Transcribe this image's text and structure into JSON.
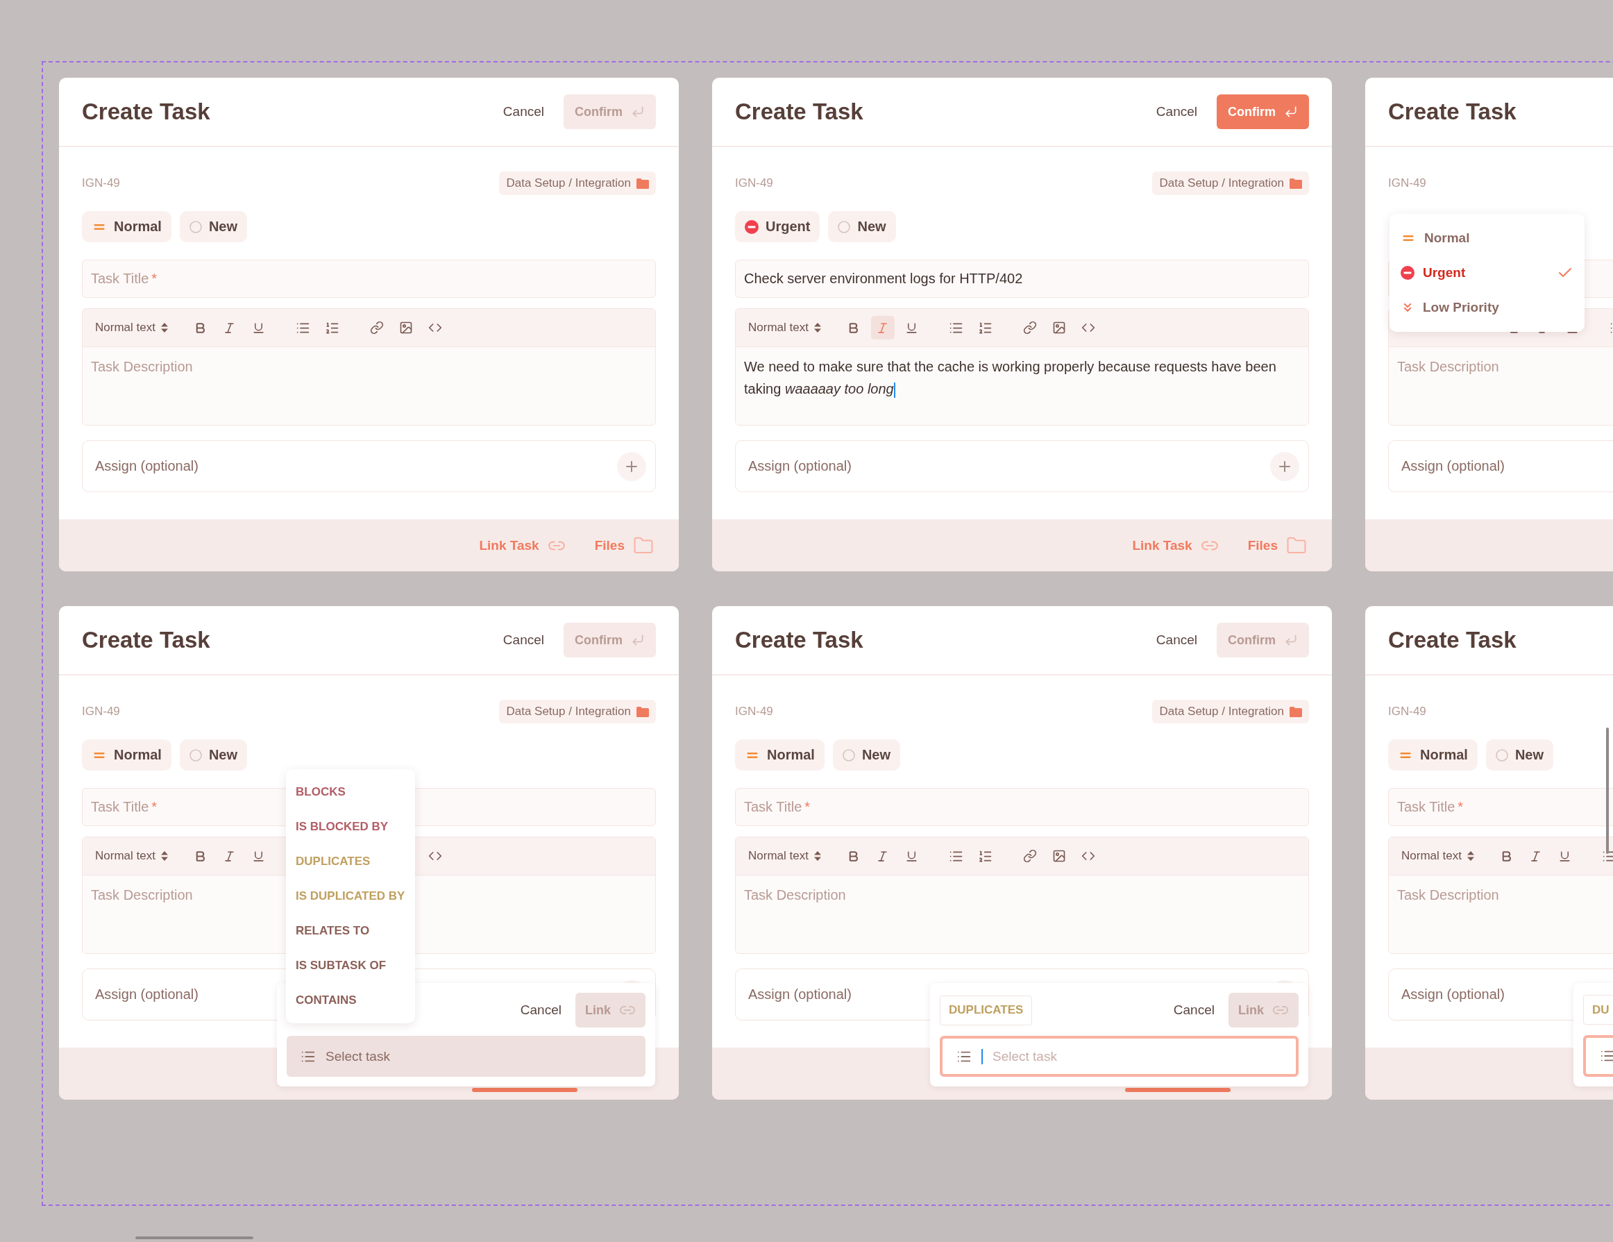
{
  "cards": [
    {
      "title": "Create Task",
      "actions": {
        "cancel": "Cancel",
        "confirm": "Confirm",
        "confirm_enabled": false
      },
      "task_id": "IGN-49",
      "category": "Data Setup / Integration",
      "priority": {
        "kind": "normal",
        "label": "Normal"
      },
      "status": "New",
      "title_field": {
        "placeholder": "Task Title",
        "required_mark": "*"
      },
      "editor": {
        "format": "Normal text",
        "italic_active": false,
        "placeholder": "Task Description"
      },
      "assign": {
        "placeholder": "Assign (optional)"
      },
      "footer": {
        "link_task": "Link Task",
        "files": "Files"
      }
    },
    {
      "title": "Create Task",
      "actions": {
        "cancel": "Cancel",
        "confirm": "Confirm",
        "confirm_enabled": true
      },
      "task_id": "IGN-49",
      "category": "Data Setup / Integration",
      "priority": {
        "kind": "urgent",
        "label": "Urgent"
      },
      "status": "New",
      "title_field": {
        "value": "Check server environment logs for HTTP/402"
      },
      "editor": {
        "format": "Normal text",
        "italic_active": true,
        "value": "We need to make sure that the cache is working properly because requests have been taking *waaaaay too long*",
        "focused": true
      },
      "assign": {
        "placeholder": "Assign (optional)"
      },
      "footer": {
        "link_task": "Link Task",
        "files": "Files"
      }
    },
    {
      "title": "Create Task",
      "task_id": "IGN-49",
      "editor": {
        "italic_active": false,
        "placeholder": "Task Description"
      },
      "assign": {
        "placeholder": "Assign (optional)"
      },
      "priority_menu": [
        {
          "kind": "normal",
          "label": "Normal",
          "selected": false
        },
        {
          "kind": "urgent",
          "label": "Urgent",
          "selected": true
        },
        {
          "kind": "low",
          "label": "Low Priority",
          "selected": false
        }
      ]
    },
    {
      "title": "Create Task",
      "actions": {
        "cancel": "Cancel",
        "confirm": "Confirm",
        "confirm_enabled": false
      },
      "task_id": "IGN-49",
      "category": "Data Setup / Integration",
      "priority": {
        "kind": "normal",
        "label": "Normal"
      },
      "status": "New",
      "title_field": {
        "placeholder": "Task Title",
        "required_mark": "*"
      },
      "editor": {
        "format": "Normal text",
        "italic_active": false,
        "placeholder": "Task Description"
      },
      "assign": {
        "placeholder": "Assign (optional)"
      },
      "footer": {
        "link_task_active": true
      },
      "link_menu": [
        {
          "label": "BLOCKS",
          "color": "#b35d66"
        },
        {
          "label": "IS BLOCKED BY",
          "color": "#b35d66"
        },
        {
          "label": "DUPLICATES",
          "color": "#bf9f5e"
        },
        {
          "label": "IS DUPLICATED BY",
          "color": "#bf9f5e"
        },
        {
          "label": "RELATES TO",
          "color": "#8c5f57"
        },
        {
          "label": "IS SUBTASK OF",
          "color": "#8c5f57"
        },
        {
          "label": "CONTAINS",
          "color": "#8c5f57"
        }
      ],
      "link_popup": {
        "cancel": "Cancel",
        "link": "Link",
        "placeholder": "Select task",
        "focused": false
      }
    },
    {
      "title": "Create Task",
      "actions": {
        "cancel": "Cancel",
        "confirm": "Confirm",
        "confirm_enabled": false
      },
      "task_id": "IGN-49",
      "category": "Data Setup / Integration",
      "priority": {
        "kind": "normal",
        "label": "Normal"
      },
      "status": "New",
      "title_field": {
        "placeholder": "Task Title",
        "required_mark": "*"
      },
      "editor": {
        "format": "Normal text",
        "italic_active": false,
        "placeholder": "Task Description"
      },
      "assign": {
        "placeholder": "Assign (optional)"
      },
      "footer": {
        "link_task_active": true
      },
      "link_popup": {
        "relation": "DUPLICATES",
        "cancel": "Cancel",
        "link": "Link",
        "placeholder": "Select task",
        "focused": true
      }
    },
    {
      "title": "Create Task",
      "task_id": "IGN-49",
      "priority": {
        "kind": "normal",
        "label": "Normal"
      },
      "status": "New",
      "title_field": {
        "placeholder": "Task Title",
        "required_mark": "*"
      },
      "editor": {
        "format": "Normal text",
        "italic_active": false,
        "placeholder": "Task Description"
      },
      "assign": {
        "placeholder": "Assign (optional)"
      },
      "link_popup": {
        "relation": "DU",
        "focused": true
      }
    }
  ]
}
